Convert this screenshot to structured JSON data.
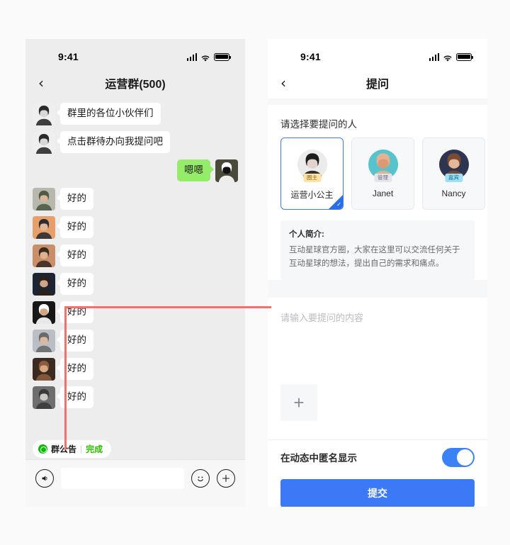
{
  "meta": {
    "accent_blue": "#3b79f6",
    "wechat_green": "#95ec69",
    "annotation_red": "#fb6d6d"
  },
  "left_phone": {
    "status": {
      "time": "9:41",
      "signal_icon": "cellular-bars-icon",
      "wifi_icon": "wifi-icon",
      "battery_icon": "battery-full-icon"
    },
    "nav": {
      "back_icon": "chevron-left-icon",
      "title": "运营群(500)"
    },
    "messages": [
      {
        "side": "left",
        "avatar": "avatar-woman-longhair",
        "text": "群里的各位小伙伴们"
      },
      {
        "side": "left",
        "avatar": "avatar-woman-longhair",
        "text": "点击群待办向我提问吧"
      },
      {
        "side": "right",
        "avatar": "avatar-panda",
        "text": "嗯嗯"
      },
      {
        "side": "left",
        "avatar": "avatar-man-bald",
        "text": "好的"
      },
      {
        "side": "left",
        "avatar": "avatar-woman-sunset",
        "text": "好的"
      },
      {
        "side": "left",
        "avatar": "avatar-woman-curly",
        "text": "好的"
      },
      {
        "side": "left",
        "avatar": "avatar-man-beard",
        "text": "好的"
      },
      {
        "side": "left",
        "avatar": "avatar-man-white-tee",
        "text": "好的"
      },
      {
        "side": "left",
        "avatar": "avatar-woman-fence",
        "text": "好的"
      },
      {
        "side": "left",
        "avatar": "avatar-man-sunglasses",
        "text": "好的"
      },
      {
        "side": "left",
        "avatar": "avatar-woman-bw",
        "text": "好的"
      }
    ],
    "announcement": {
      "icon": "group-announcement-icon",
      "label": "群公告",
      "separator": "|",
      "action": "完成"
    },
    "inputbar": {
      "voice_icon": "voice-speaker-icon",
      "field_value": "",
      "field_placeholder": "",
      "emoji_icon": "smiley-icon",
      "more_icon": "plus-circle-icon"
    }
  },
  "right_phone": {
    "status": {
      "time": "9:41",
      "signal_icon": "cellular-bars-icon",
      "wifi_icon": "wifi-icon",
      "battery_icon": "battery-full-icon"
    },
    "nav": {
      "back_icon": "chevron-left-icon",
      "title": "提问"
    },
    "picker": {
      "title": "请选择要提问的人",
      "people": [
        {
          "name": "运营小公主",
          "badge": "圈主",
          "badge_bg": "#ffe2a8",
          "badge_color": "#8a6a14",
          "avatar": "avatar-owner-woman",
          "selected": true
        },
        {
          "name": "Janet",
          "badge": "管理",
          "badge_bg": "#e3e5ea",
          "badge_color": "#6c7079",
          "avatar": "avatar-janet",
          "selected": false
        },
        {
          "name": "Nancy",
          "badge": "嘉宾",
          "badge_bg": "#9fe0f7",
          "badge_color": "#1c6b87",
          "avatar": "avatar-nancy",
          "selected": false
        },
        {
          "name": "",
          "badge": "",
          "badge_bg": "#f7f8fa",
          "badge_color": "#f7f8fa",
          "avatar": "avatar-partial",
          "selected": false
        }
      ],
      "selected_check_icon": "check-icon"
    },
    "bio": {
      "title": "个人简介:",
      "text": "互动星球官方圈，大家在这里可以交流任何关于互动星球的想法，提出自己的需求和痛点。"
    },
    "compose": {
      "placeholder": "请输入要提问的内容",
      "value": "",
      "upload_icon": "plus-icon"
    },
    "anonymous": {
      "label": "在动态中匿名显示",
      "toggle_state": "on",
      "toggle_name": "anonymous-toggle"
    },
    "submit_label": "提交"
  },
  "annotation": {
    "name": "callout-connector-line",
    "color": "#fb6d6d"
  }
}
